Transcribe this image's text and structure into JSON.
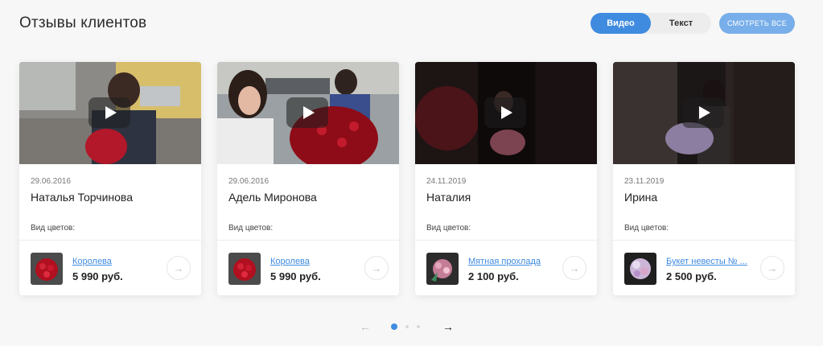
{
  "header": {
    "title": "Отзывы клиентов",
    "toggle": {
      "video": "Видео",
      "text": "Текст",
      "active": "video"
    },
    "see_all": "СМОТРЕТЬ ВСЕ"
  },
  "cards": [
    {
      "date": "29.06.2016",
      "name": "Наталья Торчинова",
      "flower_type_label": "Вид цветов:",
      "product": "Королева",
      "price": "5 990 руб."
    },
    {
      "date": "29.06.2016",
      "name": "Адель Миронова",
      "flower_type_label": "Вид цветов:",
      "product": "Королева",
      "price": "5 990 руб."
    },
    {
      "date": "24.11.2019",
      "name": "Наталия",
      "flower_type_label": "Вид цветов:",
      "product": "Мятная прохлада",
      "price": "2 100 руб."
    },
    {
      "date": "23.11.2019",
      "name": "Ирина",
      "flower_type_label": "Вид цветов:",
      "product": "Букет невесты № ...",
      "price": "2 500 руб."
    }
  ],
  "pagination": {
    "prev": "←",
    "next": "→",
    "pages": 3,
    "current": 1
  },
  "colors": {
    "accent": "#3f8be0",
    "see_all_bg": "#78aee9"
  },
  "icons": {
    "play": "play-icon",
    "arrow": "arrow-right-icon"
  }
}
